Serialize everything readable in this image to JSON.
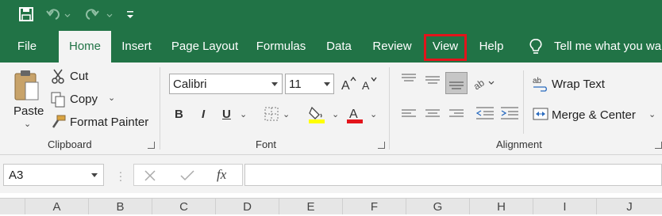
{
  "tabs": [
    "File",
    "Home",
    "Insert",
    "Page Layout",
    "Formulas",
    "Data",
    "Review",
    "View",
    "Help"
  ],
  "tell_me": "Tell me what you wa",
  "clipboard": {
    "paste": "Paste",
    "cut": "Cut",
    "copy": "Copy",
    "format_painter": "Format Painter",
    "label": "Clipboard"
  },
  "font": {
    "name": "Calibri",
    "size": "11",
    "bold": "B",
    "italic": "I",
    "underline": "U",
    "font_color_glyph": "A",
    "label": "Font",
    "colors": {
      "highlight": "#ffff00",
      "font": "#e3141b"
    }
  },
  "alignment": {
    "wrap_text": "Wrap Text",
    "merge_center": "Merge & Center",
    "label": "Alignment"
  },
  "formula_bar": {
    "name_box": "A3",
    "fx": "fx"
  },
  "columns": [
    "A",
    "B",
    "C",
    "D",
    "E",
    "F",
    "G",
    "H",
    "I",
    "J"
  ],
  "colors": {
    "excel_green": "#217346",
    "highlight_box": "#e3141b"
  }
}
